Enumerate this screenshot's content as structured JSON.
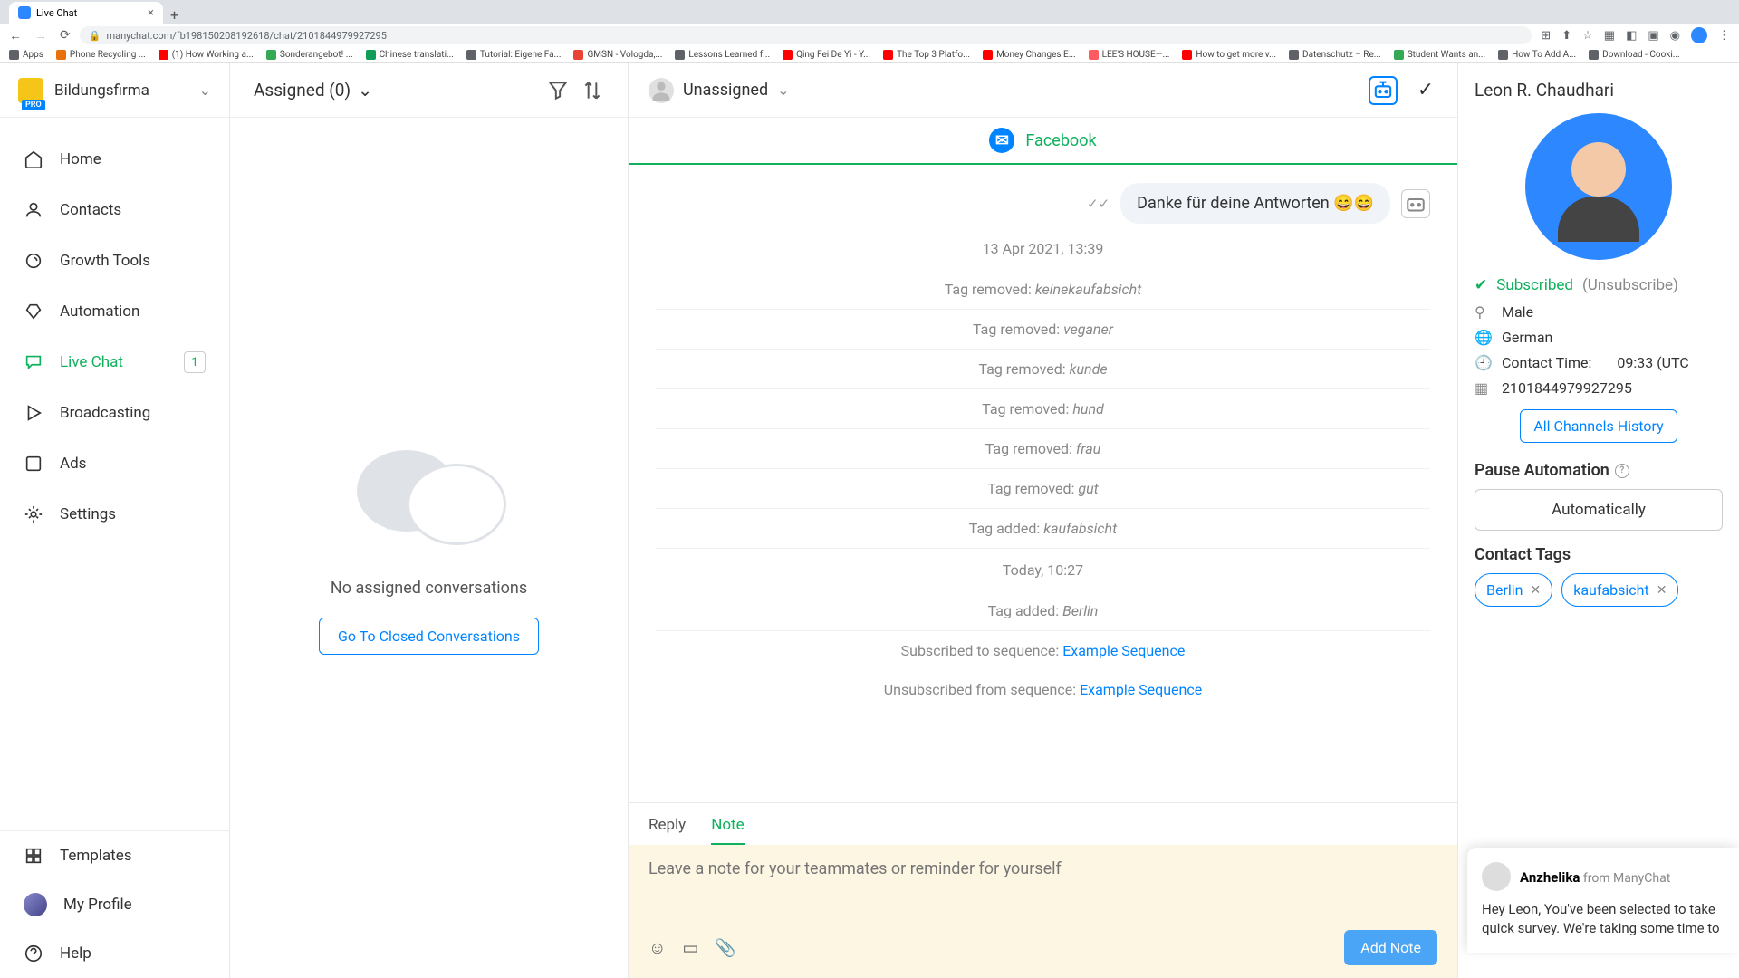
{
  "browser": {
    "tab_title": "Live Chat",
    "url": "manychat.com/fb198150208192618/chat/2101844979927295",
    "bookmarks": [
      {
        "label": "Apps",
        "color": "#5f6368"
      },
      {
        "label": "Phone Recycling ...",
        "color": "#e8710a"
      },
      {
        "label": "(1) How Working a...",
        "color": "#ff0000"
      },
      {
        "label": "Sonderangebot! ...",
        "color": "#34a853"
      },
      {
        "label": "Chinese translati...",
        "color": "#0f9d58"
      },
      {
        "label": "Tutorial: Eigene Fa...",
        "color": "#5f6368"
      },
      {
        "label": "GMSN - Vologda,...",
        "color": "#ea4335"
      },
      {
        "label": "Lessons Learned f...",
        "color": "#5f6368"
      },
      {
        "label": "Qing Fei De Yi - Y...",
        "color": "#ff0000"
      },
      {
        "label": "The Top 3 Platfo...",
        "color": "#ff0000"
      },
      {
        "label": "Money Changes E...",
        "color": "#ff0000"
      },
      {
        "label": "LEE'S HOUSE—...",
        "color": "#ff5a5f"
      },
      {
        "label": "How to get more v...",
        "color": "#ff0000"
      },
      {
        "label": "Datenschutz – Re...",
        "color": "#5f6368"
      },
      {
        "label": "Student Wants an...",
        "color": "#34a853"
      },
      {
        "label": "How To Add A...",
        "color": "#5f6368"
      },
      {
        "label": "Download - Cooki...",
        "color": "#5f6368"
      }
    ]
  },
  "workspace": {
    "name": "Bildungsfirma",
    "badge": "PRO"
  },
  "nav": {
    "home": "Home",
    "contacts": "Contacts",
    "growth": "Growth Tools",
    "automation": "Automation",
    "livechat": "Live Chat",
    "livechat_badge": "1",
    "broadcasting": "Broadcasting",
    "ads": "Ads",
    "settings": "Settings",
    "templates": "Templates",
    "profile": "My Profile",
    "help": "Help"
  },
  "list": {
    "assigned_label": "Assigned (0)",
    "empty_text": "No assigned conversations",
    "closed_btn": "Go To Closed Conversations"
  },
  "thread": {
    "assignee": "Unassigned",
    "platform": "Facebook",
    "message": "Danke für deine Antworten 😄😄",
    "events": [
      {
        "type": "timestamp",
        "text": "13 Apr 2021, 13:39"
      },
      {
        "type": "tag_removed",
        "prefix": "Tag removed: ",
        "tag": "keinekaufabsicht"
      },
      {
        "type": "tag_removed",
        "prefix": "Tag removed: ",
        "tag": "veganer"
      },
      {
        "type": "tag_removed",
        "prefix": "Tag removed: ",
        "tag": "kunde"
      },
      {
        "type": "tag_removed",
        "prefix": "Tag removed: ",
        "tag": "hund"
      },
      {
        "type": "tag_removed",
        "prefix": "Tag removed: ",
        "tag": "frau"
      },
      {
        "type": "tag_removed",
        "prefix": "Tag removed: ",
        "tag": "gut"
      },
      {
        "type": "tag_added",
        "prefix": "Tag added: ",
        "tag": "kaufabsicht"
      },
      {
        "type": "timestamp",
        "text": "Today, 10:27"
      },
      {
        "type": "tag_added",
        "prefix": "Tag added: ",
        "tag": "Berlin"
      },
      {
        "type": "sequence",
        "prefix": "Subscribed to sequence: ",
        "seq": "Example Sequence"
      },
      {
        "type": "sequence",
        "prefix": "Unsubscribed from sequence: ",
        "seq": "Example Sequence"
      }
    ],
    "tab_reply": "Reply",
    "tab_note": "Note",
    "note_placeholder": "Leave a note for your teammates or reminder for yourself",
    "add_note_btn": "Add Note"
  },
  "contact": {
    "name": "Leon R. Chaudhari",
    "subscribed": "Subscribed",
    "unsubscribe": "(Unsubscribe)",
    "gender": "Male",
    "language": "German",
    "contact_time_label": "Contact Time:",
    "contact_time_value": "09:33 (UTC",
    "id": "2101844979927295",
    "channels_btn": "All Channels History",
    "pause_label": "Pause Automation",
    "auto_btn": "Automatically",
    "tags_label": "Contact Tags",
    "tags": [
      "Berlin",
      "kaufabsicht"
    ]
  },
  "popup": {
    "name": "Anzhelika",
    "from": " from ManyChat",
    "body": "Hey Leon,  You've been selected to take quick survey. We're taking some time to"
  }
}
